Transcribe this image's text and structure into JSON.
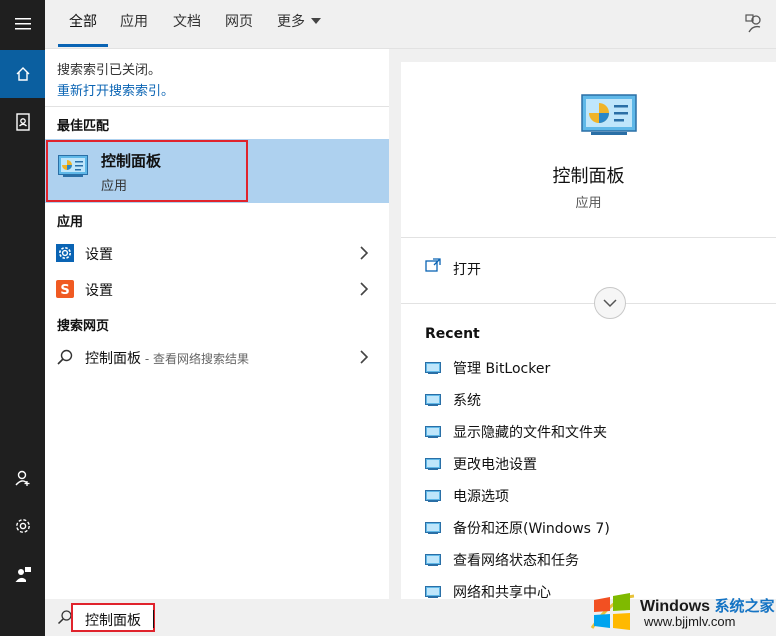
{
  "tabs": [
    {
      "label": "全部",
      "active": true
    },
    {
      "label": "应用",
      "active": false
    },
    {
      "label": "文档",
      "active": false
    },
    {
      "label": "网页",
      "active": false
    },
    {
      "label": "更多",
      "active": false
    }
  ],
  "sidebar_icons": [
    "menu-icon",
    "home-icon",
    "notebook-icon",
    "person-icon",
    "settings-icon",
    "feedback-user-icon"
  ],
  "notice": {
    "line1": "搜索索引已关闭。",
    "link": "重新打开搜索索引。"
  },
  "best_match": {
    "section": "最佳匹配",
    "title": "控制面板",
    "subtitle": "应用"
  },
  "apps": {
    "section": "应用",
    "items": [
      {
        "label": "设置",
        "icon": "gear-blue-icon"
      },
      {
        "label": "设置",
        "icon": "sogou-s-icon"
      }
    ]
  },
  "web": {
    "section": "搜索网页",
    "item_label": "控制面板",
    "item_hint": " - 查看网络搜索结果"
  },
  "search": {
    "value": "控制面板"
  },
  "detail": {
    "title": "控制面板",
    "subtitle": "应用",
    "open_label": "打开",
    "recent_heading": "Recent",
    "recent": [
      "管理 BitLocker",
      "系统",
      "显示隐藏的文件和文件夹",
      "更改电池设置",
      "电源选项",
      "备份和还原(Windows 7)",
      "查看网络状态和任务",
      "网络和共享中心"
    ]
  },
  "watermark": {
    "brand": "Windows",
    "brand_cn": "系统之家",
    "url": "www.bjjmlv.com"
  },
  "colors": {
    "accent": "#0a64b4",
    "highlight": "#aed1ef",
    "annotation_red": "#e0232c",
    "sidebar": "#1f1f1f"
  }
}
